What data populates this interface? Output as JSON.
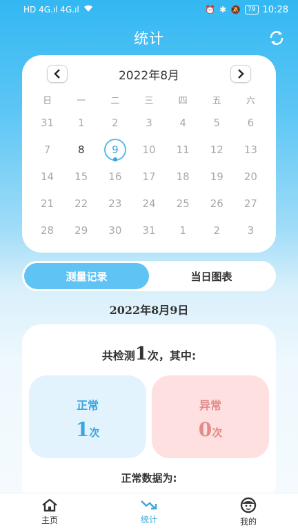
{
  "status_bar": {
    "left_indicators": "HD 4G.ıl 4G.ıl",
    "battery": "79",
    "time": "10:28"
  },
  "header": {
    "title": "统计",
    "refresh_icon": "refresh-icon"
  },
  "calendar": {
    "month_title": "2022年8月",
    "weekdays": [
      "日",
      "一",
      "二",
      "三",
      "四",
      "五",
      "六"
    ],
    "weeks": [
      [
        "31",
        "1",
        "2",
        "3",
        "4",
        "5",
        "6"
      ],
      [
        "7",
        "8",
        "9",
        "10",
        "11",
        "12",
        "13"
      ],
      [
        "14",
        "15",
        "16",
        "17",
        "18",
        "19",
        "20"
      ],
      [
        "21",
        "22",
        "23",
        "24",
        "25",
        "26",
        "27"
      ],
      [
        "28",
        "29",
        "30",
        "31",
        "1",
        "2",
        "3"
      ]
    ],
    "today": "8",
    "selected": "9"
  },
  "tabs": [
    {
      "label": "测量记录",
      "active": true
    },
    {
      "label": "当日图表",
      "active": false
    }
  ],
  "record": {
    "date_title": "2022年8月9日",
    "count_prefix": "共检测",
    "count": "1",
    "count_suffix": "次，其中:",
    "normal_label": "正常",
    "normal_count": "1",
    "abnormal_label": "异常",
    "abnormal_count": "0",
    "unit": "次",
    "normal_data_title": "正常数据为:"
  },
  "bottom_nav": {
    "home": "主页",
    "stats": "统计",
    "mine": "我的"
  },
  "colors": {
    "accent": "#3aa5db",
    "normal_bg": "#e3f3fd",
    "abnormal_bg": "#fde0df",
    "abnormal_text": "#e28b89"
  }
}
